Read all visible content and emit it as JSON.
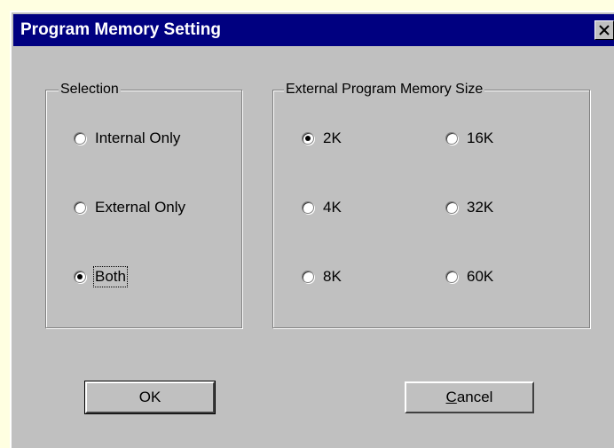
{
  "dialog": {
    "title": "Program Memory Setting",
    "close_glyph": "×"
  },
  "selection": {
    "label": "Selection",
    "options": [
      {
        "label": "Internal Only",
        "checked": false
      },
      {
        "label": "External Only",
        "checked": false
      },
      {
        "label": "Both",
        "checked": true
      }
    ]
  },
  "memory_size": {
    "label": "External Program Memory Size",
    "options": [
      {
        "label": "2K",
        "checked": true
      },
      {
        "label": "16K",
        "checked": false
      },
      {
        "label": "4K",
        "checked": false
      },
      {
        "label": "32K",
        "checked": false
      },
      {
        "label": "8K",
        "checked": false
      },
      {
        "label": "60K",
        "checked": false
      }
    ]
  },
  "buttons": {
    "ok_label": "OK",
    "cancel_label": "Cancel"
  },
  "colors": {
    "titlebar": "#000080",
    "dialog_face": "#c0c0c0",
    "background": "#ffffe1"
  }
}
